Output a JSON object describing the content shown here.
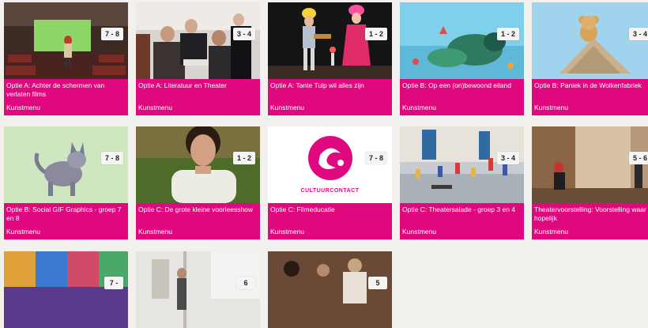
{
  "cards": [
    {
      "title": "Optie A: Achter de schermen van verlaten films",
      "tag": "Kunstmenu",
      "badge": "7 - 8",
      "scene": "cinema"
    },
    {
      "title": "Optie A: Literatuur en Theater",
      "tag": "Kunstmenu",
      "badge": "3 - 4",
      "scene": "crowd"
    },
    {
      "title": "Optie A: Tante Tulp wil alles zijn",
      "tag": "Kunstmenu",
      "badge": "1 - 2",
      "scene": "stage"
    },
    {
      "title": "Optie B: Op een (on)bewoond eiland",
      "tag": "Kunstmenu",
      "badge": "1 - 2",
      "scene": "island"
    },
    {
      "title": "Optie B: Paniek in de Wolkenfabriek",
      "tag": "Kunstmenu",
      "badge": "3 - 4",
      "scene": "bear"
    },
    {
      "title": "Optie B: Social GIF Graphics - groep 7 en 8",
      "tag": "Kunstmenu",
      "badge": "7 - 8",
      "scene": "cat"
    },
    {
      "title": "Optie C: De grote kleine voorleesshow",
      "tag": "Kunstmenu",
      "badge": "1 - 2",
      "scene": "girl"
    },
    {
      "title": "Optie C: Filmeducatie",
      "tag": "Kunstmenu",
      "badge": "7 - 8",
      "scene": "logo",
      "logo_text": "CULTUURCONTACT"
    },
    {
      "title": "Optie C: Theatersalade - groep 3 en 4",
      "tag": "Kunstmenu",
      "badge": "3 - 4",
      "scene": "gym"
    },
    {
      "title": "Theatervoorstelling: Voorstelling waar hopelijk",
      "tag": "Kunstmenu",
      "badge": "5 - 6",
      "scene": "theater"
    },
    {
      "title": "",
      "tag": "",
      "badge": "7 -",
      "scene": "colorful"
    },
    {
      "title": "",
      "tag": "",
      "badge": "6",
      "scene": "studio"
    },
    {
      "title": "",
      "tag": "",
      "badge": "5",
      "scene": "class"
    }
  ],
  "colors": {
    "accent": "#e0087e",
    "background": "#f2f1ee"
  }
}
